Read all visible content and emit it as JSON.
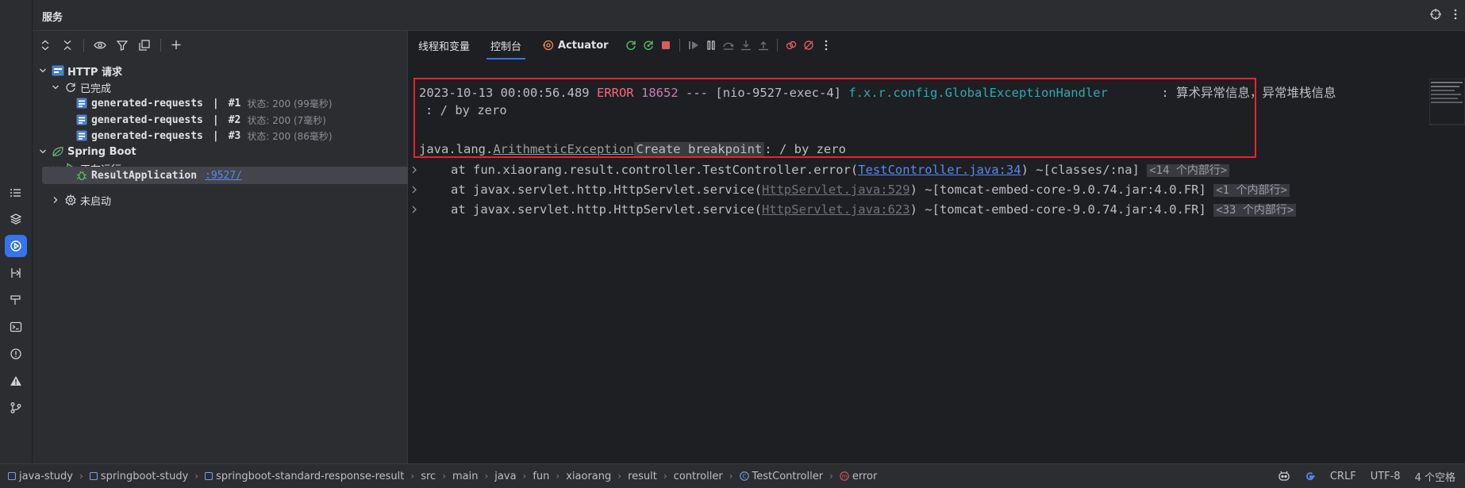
{
  "panel": {
    "title": "服务"
  },
  "tree": {
    "http_group": "HTTP 请求",
    "done_group": "已完成",
    "requests": [
      {
        "name": "generated-requests",
        "sep": "|",
        "num": "#1",
        "status": "状态: 200 (99毫秒)"
      },
      {
        "name": "generated-requests",
        "sep": "|",
        "num": "#2",
        "status": "状态: 200 (7毫秒)"
      },
      {
        "name": "generated-requests",
        "sep": "|",
        "num": "#3",
        "status": "状态: 200 (86毫秒)"
      }
    ],
    "spring_group": "Spring Boot",
    "running_group": "正在运行",
    "app_name": "ResultApplication",
    "app_port": ":9527/",
    "not_started": "未启动"
  },
  "tabs": [
    {
      "label": "线程和变量"
    },
    {
      "label": "控制台"
    },
    {
      "label": "Actuator"
    }
  ],
  "log": {
    "l1_time": "2023-10-13 00:00:56.489",
    "l1_level": "ERROR",
    "l1_pid": "18652",
    "l1_sep": "---",
    "l1_thread": "[nio-9527-exec-4]",
    "l1_class": "f.x.r.config.GlobalExceptionHandler",
    "l1_msg": ": 算术异常信息，异常堆栈信息",
    "l2_msg": ": / by zero",
    "l3_prefix": "java.lang.",
    "l3_exc": "ArithmeticException",
    "l3_bp": "Create breakpoint",
    "l3_msg": ": / by zero",
    "frames": [
      {
        "text": "at fun.xiaorang.result.controller.TestController.error(",
        "link": "TestController.java:34",
        "tail": ") ~[classes/:na]",
        "fold": "<14 个内部行>"
      },
      {
        "text": "at javax.servlet.http.HttpServlet.service(",
        "link": "HttpServlet.java:529",
        "tail": ") ~[tomcat-embed-core-9.0.74.jar:4.0.FR]",
        "fold": "<1 个内部行>"
      },
      {
        "text": "at javax.servlet.http.HttpServlet.service(",
        "link": "HttpServlet.java:623",
        "tail": ") ~[tomcat-embed-core-9.0.74.jar:4.0.FR]",
        "fold": "<33 个内部行>"
      }
    ]
  },
  "breadcrumbs": [
    "java-study",
    "springboot-study",
    "springboot-standard-response-result",
    "src",
    "main",
    "java",
    "fun",
    "xiaorang",
    "result",
    "controller",
    "TestController",
    "error"
  ],
  "status": {
    "line_sep": "CRLF",
    "encoding": "UTF-8",
    "indent": "4 个空格"
  },
  "colors": {
    "accent": "#3574f0",
    "error": "#fa6675",
    "highlight_box": "#e5252a"
  }
}
